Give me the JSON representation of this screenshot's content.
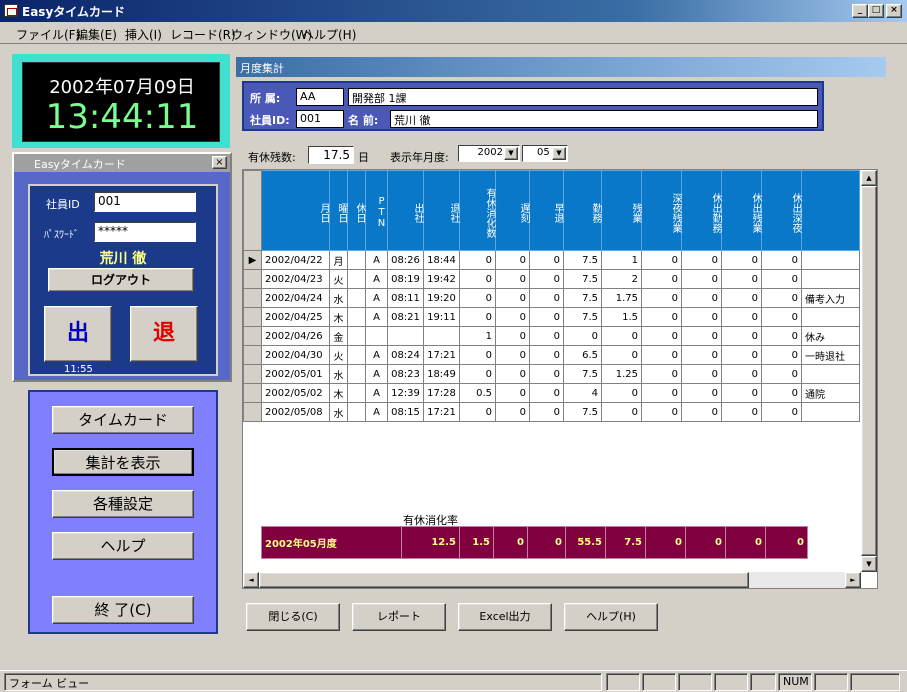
{
  "app": {
    "title": "Easyタイムカード"
  },
  "window_buttons": {
    "minimize": "_",
    "maximize": "□",
    "close": "×"
  },
  "menu": [
    "ファイル(F)",
    "編集(E)",
    "挿入(I)",
    "レコード(R)",
    "ウィンドウ(W)",
    "ヘルプ(H)"
  ],
  "clock": {
    "date": "2002年07月09日",
    "time": "13:44:11"
  },
  "login": {
    "window_title": "Easyタイムカード",
    "close": "×",
    "id_label": "社員ID",
    "id_value": "001",
    "pw_label": "ﾊﾟｽﾜｰﾄﾞ",
    "pw_value": "*****",
    "user_name": "荒川 徹",
    "logout": "ログアウト",
    "in": "出",
    "out": "退",
    "in_time": "11:55"
  },
  "nav": {
    "timecard": "タイムカード",
    "summary": "集計を表示",
    "settings": "各種設定",
    "help": "ヘルプ",
    "exit": "終 了(C)"
  },
  "main": {
    "title": "月度集計",
    "dept_label": "所 属:",
    "dept_code": "AA",
    "dept_name": "開発部 1課",
    "empid_label": "社員ID:",
    "empid": "001",
    "name_label": "名 前:",
    "name": "荒川 徹",
    "paid_leave_label": "有休残数:",
    "paid_leave_value": "17.5",
    "paid_leave_unit": "日",
    "period_label": "表示年月度:",
    "year": "2002",
    "month": "05",
    "columns": [
      "月日",
      "曜日",
      "休日",
      "PTN",
      "出社",
      "退社",
      "有休消化数",
      "遅刻",
      "早退",
      "勤務",
      "残業",
      "深夜残業",
      "休出勤務",
      "休出残業",
      "休出深夜",
      ""
    ],
    "rows": [
      [
        "2002/04/22",
        "月",
        "",
        "A",
        "08:26",
        "18:44",
        "0",
        "0",
        "0",
        "7.5",
        "1",
        "0",
        "0",
        "0",
        "0",
        ""
      ],
      [
        "2002/04/23",
        "火",
        "",
        "A",
        "08:19",
        "19:42",
        "0",
        "0",
        "0",
        "7.5",
        "2",
        "0",
        "0",
        "0",
        "0",
        ""
      ],
      [
        "2002/04/24",
        "水",
        "",
        "A",
        "08:11",
        "19:20",
        "0",
        "0",
        "0",
        "7.5",
        "1.75",
        "0",
        "0",
        "0",
        "0",
        "備考入力"
      ],
      [
        "2002/04/25",
        "木",
        "",
        "A",
        "08:21",
        "19:11",
        "0",
        "0",
        "0",
        "7.5",
        "1.5",
        "0",
        "0",
        "0",
        "0",
        ""
      ],
      [
        "2002/04/26",
        "金",
        "",
        "",
        "",
        "",
        "1",
        "0",
        "0",
        "0",
        "0",
        "0",
        "0",
        "0",
        "0",
        "休み"
      ],
      [
        "2002/04/30",
        "火",
        "",
        "A",
        "08:24",
        "17:21",
        "0",
        "0",
        "0",
        "6.5",
        "0",
        "0",
        "0",
        "0",
        "0",
        "一時退社"
      ],
      [
        "2002/05/01",
        "水",
        "",
        "A",
        "08:23",
        "18:49",
        "0",
        "0",
        "0",
        "7.5",
        "1.25",
        "0",
        "0",
        "0",
        "0",
        ""
      ],
      [
        "2002/05/02",
        "木",
        "",
        "A",
        "12:39",
        "17:28",
        "0.5",
        "0",
        "0",
        "4",
        "0",
        "0",
        "0",
        "0",
        "0",
        "通院"
      ],
      [
        "2002/05/08",
        "水",
        "",
        "A",
        "08:15",
        "17:21",
        "0",
        "0",
        "0",
        "7.5",
        "0",
        "0",
        "0",
        "0",
        "0",
        ""
      ]
    ],
    "selected_row_marker": "▶",
    "scroll_up": "▲",
    "scroll_down": "▼",
    "scroll_left": "◄",
    "scroll_right": "►",
    "usage_rate_label": "有休消化率",
    "totals": {
      "label": "2002年05月度",
      "paid": "12.5",
      "late": "1.5",
      "early": "0",
      "x": "0",
      "work": "55.5",
      "ot": "7.5",
      "night": "0",
      "hw": "0",
      "ho": "0",
      "hn": "0"
    },
    "buttons": {
      "close": "閉じる(C)",
      "report": "レポート",
      "excel": "Excel出力",
      "help": "ヘルプ(H)"
    }
  },
  "status": {
    "text": "フォーム ビュー",
    "num": "NUM"
  }
}
